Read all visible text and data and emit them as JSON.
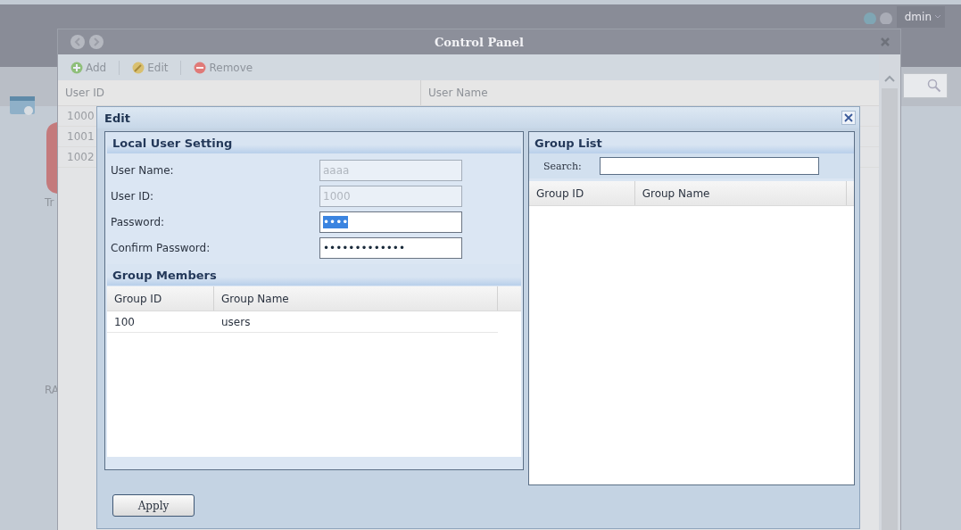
{
  "background": {
    "user": "dmin",
    "side_labels": [
      "Tr",
      "RA"
    ]
  },
  "control_panel": {
    "title": "Control Panel",
    "toolbar": [
      {
        "label": "Add",
        "kind": "add"
      },
      {
        "label": "Edit",
        "kind": "edit"
      },
      {
        "label": "Remove",
        "kind": "remove"
      }
    ],
    "columns": [
      "User ID",
      "User Name"
    ],
    "rows": [
      "1000",
      "1001",
      "1002"
    ]
  },
  "edit_dialog": {
    "title": "Edit",
    "local_user_setting": {
      "title": "Local User Setting",
      "fields": [
        {
          "label": "User Name:",
          "value": "aaaa",
          "disabled": true,
          "highlighted": false
        },
        {
          "label": "User ID:",
          "value": "1000",
          "disabled": true,
          "highlighted": false
        },
        {
          "label": "Password:",
          "value": "••••",
          "disabled": false,
          "highlighted": true
        },
        {
          "label": "Confirm Password:",
          "value": "•••••••••••••",
          "disabled": false,
          "highlighted": false
        }
      ]
    },
    "group_members": {
      "title": "Group Members",
      "columns": [
        "Group ID",
        "Group Name"
      ],
      "rows": [
        [
          "100",
          "users"
        ]
      ]
    },
    "group_list": {
      "title": "Group List",
      "search_label": "Search:",
      "columns": [
        "Group ID",
        "Group Name"
      ]
    },
    "apply": "Apply"
  }
}
